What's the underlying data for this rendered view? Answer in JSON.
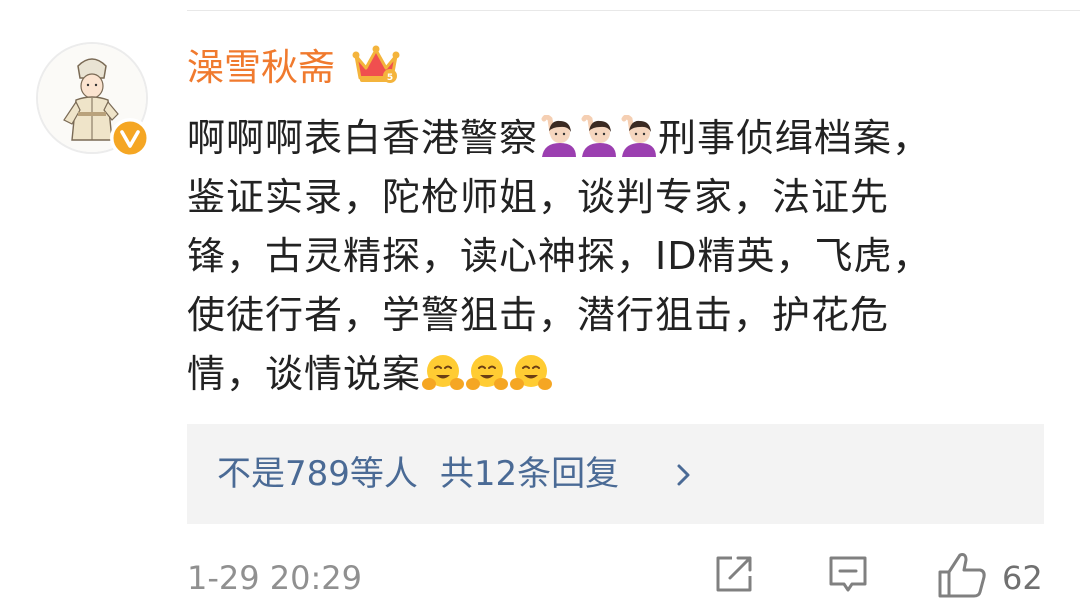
{
  "comment": {
    "username": "澡雪秋斋",
    "badge_icon": "crown-vip-icon",
    "verified_icon": "verified-v-icon",
    "lines": [
      {
        "text": "啊啊啊表白香港警察",
        "emojis_after": "raising-hand-woman",
        "emoji_count": 3,
        "tail": "刑事侦缉档案，"
      },
      {
        "text": "鉴证实录，陀枪师姐，谈判专家，法证先"
      },
      {
        "text": "锋，古灵精探，读心神探，ID精英，飞虎，"
      },
      {
        "text": "使徒行者，学警狙击，潜行狙击，护花危"
      },
      {
        "text": "情，谈情说案",
        "emojis_after": "hugging-face",
        "emoji_count": 3
      }
    ]
  },
  "replies": {
    "liked_by": "不是789等人",
    "reply_count": "共12条回复"
  },
  "footer": {
    "timestamp": "1-29 20:29",
    "like_count": "62"
  },
  "colors": {
    "username": "#f07a2e",
    "link": "#4a6a95",
    "text": "#222222",
    "meta": "#909090",
    "replies_bg": "#f3f3f3",
    "verified": "#f5a623"
  }
}
